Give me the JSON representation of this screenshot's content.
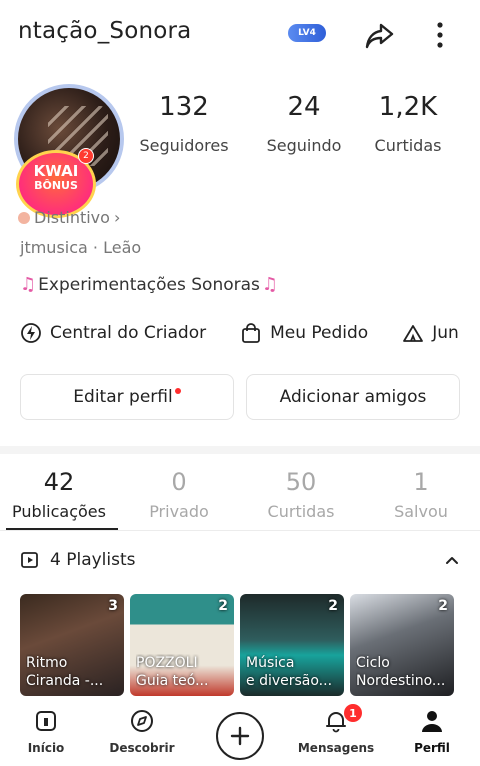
{
  "header": {
    "username": "ntação_Sonora",
    "level_badge": "LV4"
  },
  "avatar": {
    "badge_line1": "KWAI",
    "badge_line2": "BÔNUS",
    "badge_count": "2"
  },
  "stats": [
    {
      "value": "132",
      "label": "Seguidores"
    },
    {
      "value": "24",
      "label": "Seguindo"
    },
    {
      "value": "1,2K",
      "label": "Curtidas"
    }
  ],
  "profile": {
    "distintivo": "Distintivo",
    "handle": "jtmusica · Leão",
    "bio": "Experimentações Sonoras"
  },
  "creator_row": [
    {
      "label": "Central do Criador",
      "icon": "lightning-circle-icon"
    },
    {
      "label": "Meu Pedido",
      "icon": "shopping-bag-icon"
    },
    {
      "label": "Jun",
      "icon": "tent-icon"
    }
  ],
  "buttons": {
    "edit_profile": "Editar perfil",
    "add_friends": "Adicionar amigos"
  },
  "tabs": [
    {
      "count": "42",
      "label": "Publicações",
      "active": true
    },
    {
      "count": "0",
      "label": "Privado",
      "active": false
    },
    {
      "count": "50",
      "label": "Curtidas",
      "active": false
    },
    {
      "count": "1",
      "label": "Salvou",
      "active": false
    }
  ],
  "playlists": {
    "header": "4 Playlists",
    "items": [
      {
        "count": "3",
        "title": "Ritmo\nCiranda -..."
      },
      {
        "count": "2",
        "title": "POZZOLI\nGuia teó..."
      },
      {
        "count": "2",
        "title": "Música\ne diversão..."
      },
      {
        "count": "2",
        "title": "Ciclo\nNordestino..."
      }
    ]
  },
  "nav": {
    "items": [
      {
        "label": "Início",
        "icon": "home-icon"
      },
      {
        "label": "Descobrir",
        "icon": "compass-icon"
      },
      {
        "label": "Mensagens",
        "icon": "bell-icon",
        "badge": "1"
      },
      {
        "label": "Perfil",
        "icon": "person-icon"
      }
    ]
  },
  "colors": {
    "accent_red": "#ff2d2d",
    "note_pink": "#e45aa5",
    "level_blue": "#2f5fd8"
  }
}
